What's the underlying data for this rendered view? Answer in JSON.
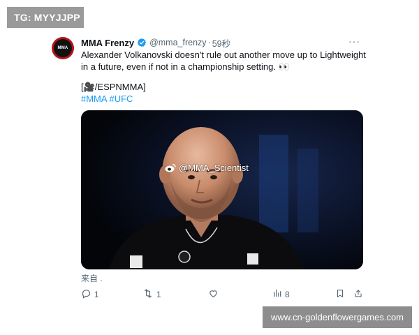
{
  "watermarks": {
    "top": "TG: MYYJJPP",
    "bottom": "www.cn-goldenflowergames.com"
  },
  "tweet": {
    "avatar_text": "MMA",
    "author_name": "MMA Frenzy",
    "handle": "@mma_frenzy",
    "separator": "·",
    "time": "59秒",
    "more_label": "···",
    "text": "Alexander Volkanovski doesn't rule out another move up to Lightweight in a future, even if not in a championship setting. 👀",
    "credit": "[🎥/ESPNMMA]",
    "hashtags": [
      "#MMA",
      "#UFC"
    ],
    "media_watermark": "@MMA_Scientist",
    "from_label": "来自 ."
  },
  "actions": {
    "reply_count": "1",
    "retweet_count": "1",
    "views_count": "8"
  },
  "colors": {
    "accent": "#1d9bf0",
    "text": "#0f1419",
    "muted": "#536471"
  },
  "icons": [
    "verified-badge-icon",
    "more-icon",
    "reply-icon",
    "retweet-icon",
    "like-icon",
    "views-icon",
    "bookmark-icon",
    "share-icon",
    "weibo-icon"
  ]
}
